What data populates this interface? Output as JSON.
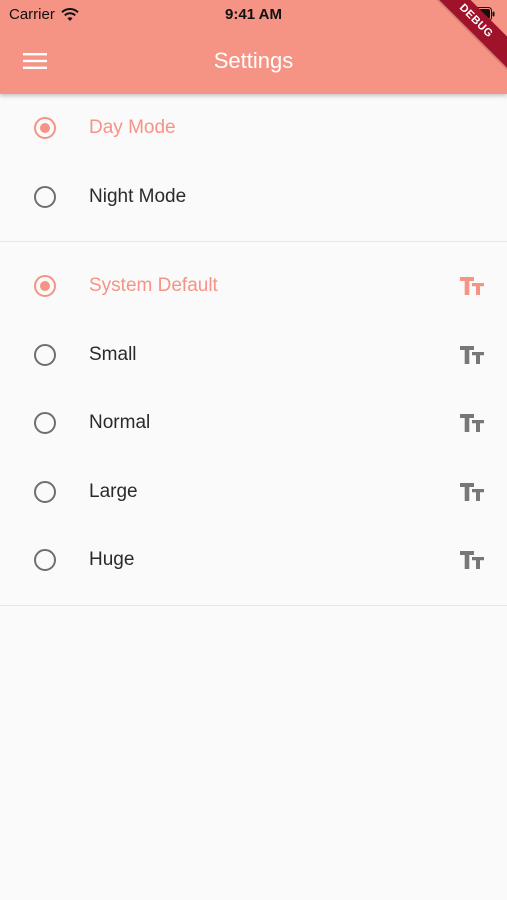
{
  "status": {
    "carrier": "Carrier",
    "time": "9:41 AM"
  },
  "app_bar": {
    "title": "Settings",
    "debug_label": "DEBUG",
    "color": "#f59384"
  },
  "theme_options": [
    {
      "label": "Day Mode",
      "selected": true
    },
    {
      "label": "Night Mode",
      "selected": false
    }
  ],
  "text_size_options": [
    {
      "label": "System Default",
      "selected": true,
      "icon": "text-size-icon"
    },
    {
      "label": "Small",
      "selected": false,
      "icon": "text-size-icon"
    },
    {
      "label": "Normal",
      "selected": false,
      "icon": "text-size-icon"
    },
    {
      "label": "Large",
      "selected": false,
      "icon": "text-size-icon"
    },
    {
      "label": "Huge",
      "selected": false,
      "icon": "text-size-icon"
    }
  ],
  "colors": {
    "accent": "#f59384",
    "inactive": "#6f6f6f"
  }
}
